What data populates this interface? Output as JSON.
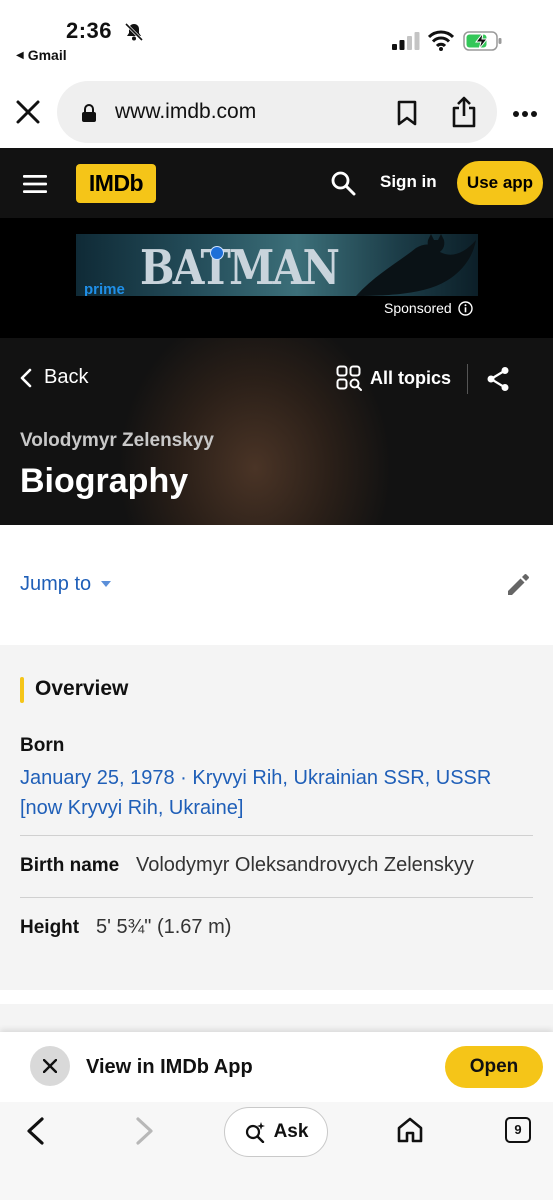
{
  "status_bar": {
    "time": "2:36",
    "back_app": "Gmail"
  },
  "browser": {
    "url": "www.imdb.com"
  },
  "header": {
    "logo": "IMDb",
    "sign_in": "Sign in",
    "use_app": "Use app"
  },
  "ad": {
    "brand": "prime",
    "title": "BATMAN",
    "sponsored_label": "Sponsored"
  },
  "hero": {
    "back_label": "Back",
    "all_topics_label": "All topics",
    "person_name": "Volodymyr Zelenskyy",
    "page_title": "Biography"
  },
  "jump": {
    "label": "Jump to"
  },
  "overview": {
    "title": "Overview",
    "born": {
      "label": "Born",
      "date_link": "January 25",
      "comma": ",",
      "year_link": "1978",
      "separator": " · ",
      "place_link": "Kryvyi Rih, Ukrainian SSR, USSR [now Kryvyi Rih, Ukraine]"
    },
    "birth_name": {
      "label": "Birth name",
      "value": "Volodymyr Oleksandrovych Zelenskyy"
    },
    "height": {
      "label": "Height",
      "value": "5' 5¾\" (1.67 m)"
    }
  },
  "app_banner": {
    "text": "View in IMDb App",
    "open_label": "Open"
  },
  "toolbar": {
    "ask_label": "Ask",
    "tab_count": "9"
  },
  "colors": {
    "imdb_yellow": "#f5c518",
    "link_blue": "#1f5fb8",
    "header_bg": "#121212",
    "overview_bg": "#f4f4f4"
  },
  "icons": [
    "bell-off-icon",
    "signal-icon",
    "wifi-icon",
    "battery-charging-icon",
    "close-icon",
    "lock-icon",
    "bookmark-icon",
    "share-icon",
    "more-icon",
    "hamburger-icon",
    "search-icon",
    "info-icon",
    "chevron-left-icon",
    "grid-search-icon",
    "share-nodes-icon",
    "caret-down-icon",
    "pencil-icon",
    "sparkle-search-icon",
    "home-icon",
    "tabs-icon"
  ]
}
